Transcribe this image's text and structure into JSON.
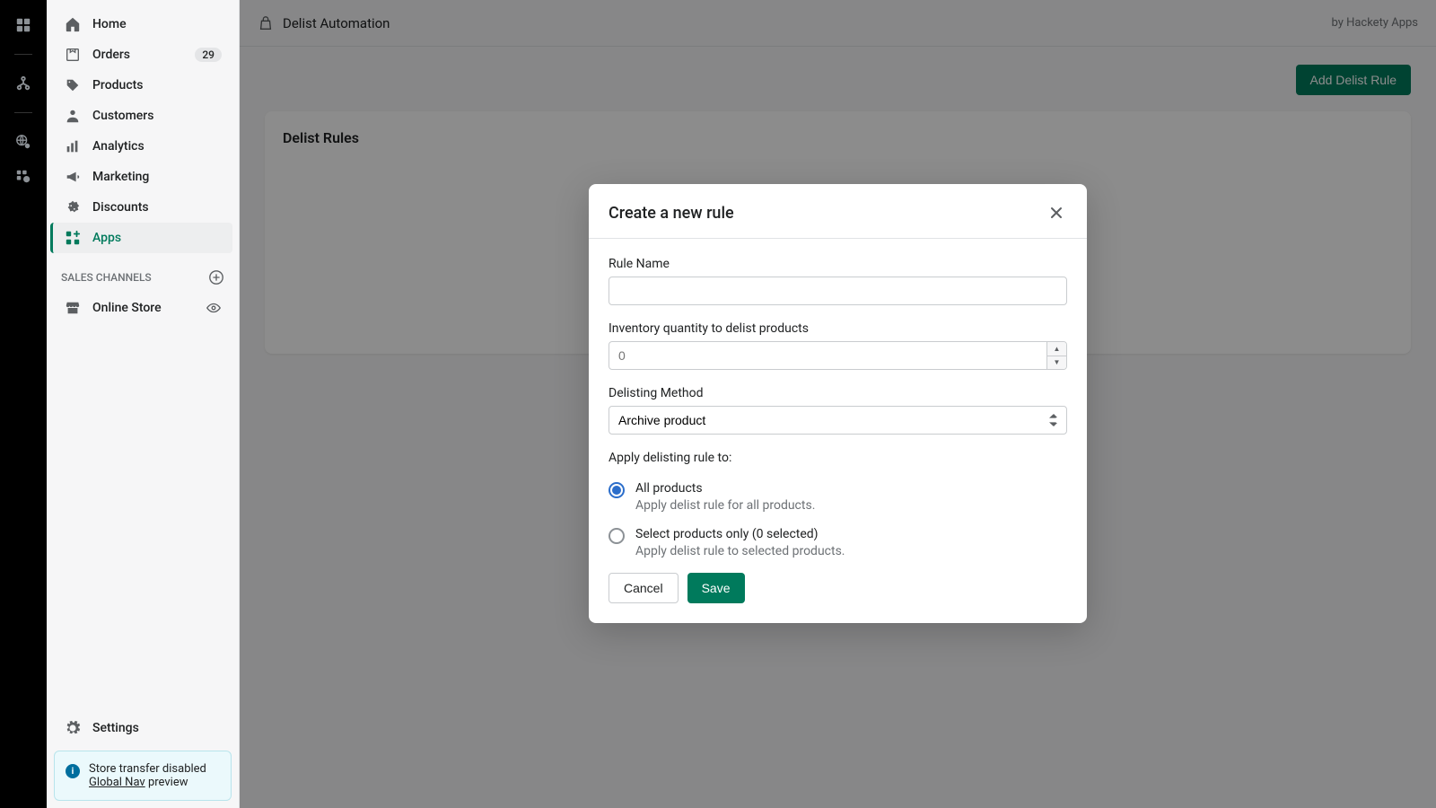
{
  "rail": {},
  "sidebar": {
    "items": [
      {
        "label": "Home"
      },
      {
        "label": "Orders",
        "badge": "29"
      },
      {
        "label": "Products"
      },
      {
        "label": "Customers"
      },
      {
        "label": "Analytics"
      },
      {
        "label": "Marketing"
      },
      {
        "label": "Discounts"
      },
      {
        "label": "Apps"
      }
    ],
    "section_label": "SALES CHANNELS",
    "channels": [
      {
        "label": "Online Store"
      }
    ],
    "settings_label": "Settings",
    "info": {
      "line1": "Store transfer disabled",
      "link_text": "Global Nav",
      "tail": " preview"
    }
  },
  "topbar": {
    "app_name": "Delist Automation",
    "by": "by Hackety Apps"
  },
  "page": {
    "add_button": "Add Delist Rule",
    "card_title": "Delist Rules"
  },
  "modal": {
    "title": "Create a new rule",
    "rule_name_label": "Rule Name",
    "rule_name_value": "",
    "qty_label": "Inventory quantity to delist products",
    "qty_placeholder": "0",
    "method_label": "Delisting Method",
    "method_value": "Archive product",
    "apply_label": "Apply delisting rule to:",
    "options": [
      {
        "label": "All products",
        "desc": "Apply delist rule for all products.",
        "selected": true
      },
      {
        "label": "Select products only (0 selected)",
        "desc": "Apply delist rule to selected products.",
        "selected": false
      }
    ],
    "cancel": "Cancel",
    "save": "Save"
  }
}
